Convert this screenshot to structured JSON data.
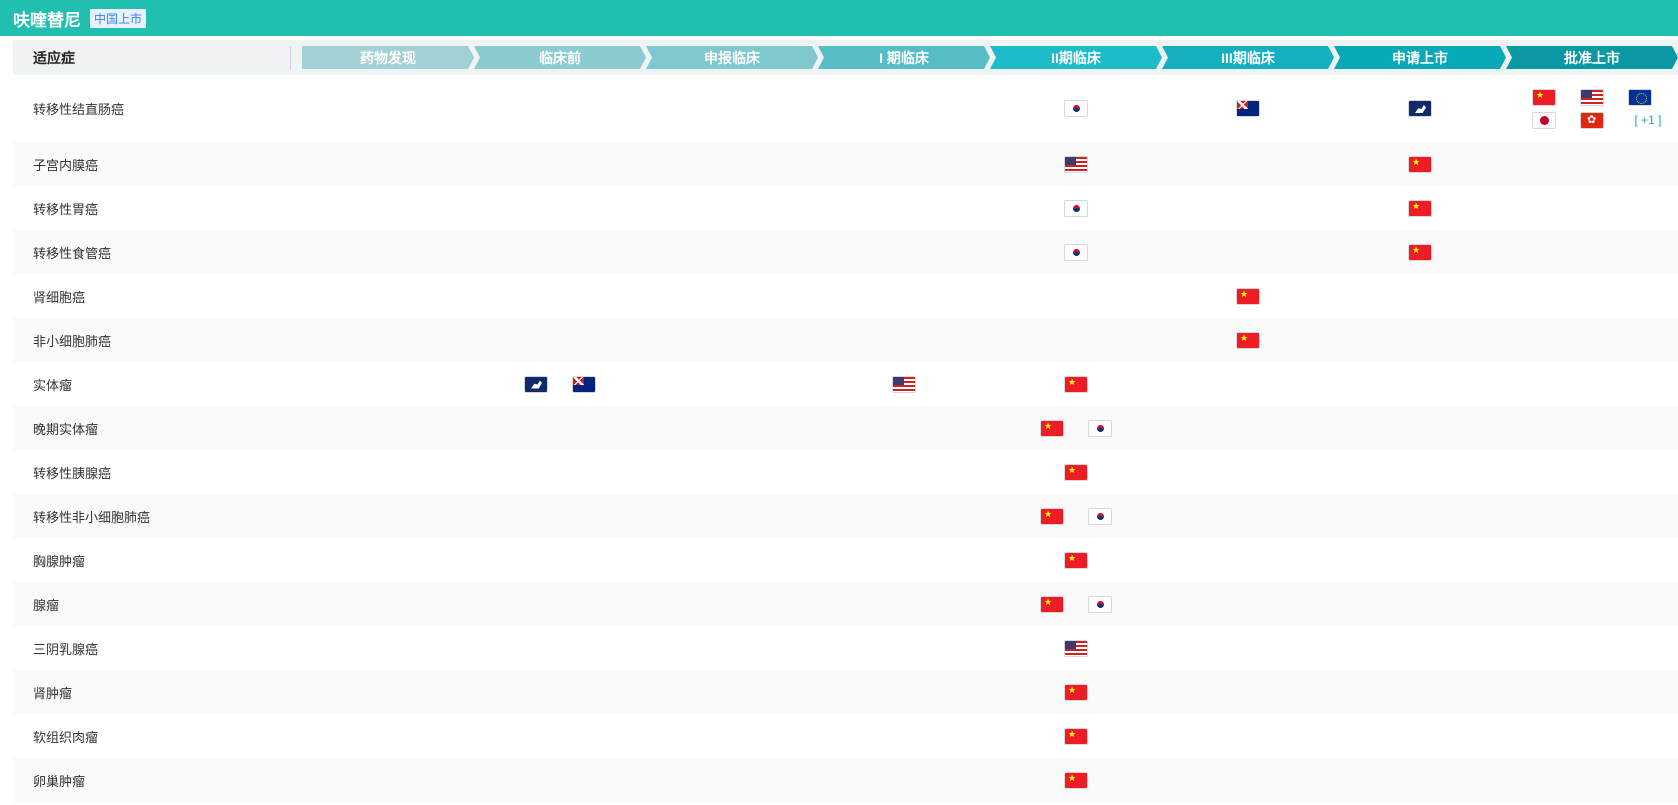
{
  "header": {
    "title": "呋喹替尼",
    "badge": "中国上市"
  },
  "table": {
    "indication_header": "适应症",
    "stages": [
      "药物发现",
      "临床前",
      "申报临床",
      "I 期临床",
      "II期临床",
      "III期临床",
      "申请上市",
      "批准上市"
    ],
    "stage_colors": [
      "#a3d0d5",
      "#8ccbd0",
      "#7ec8ce",
      "#56bdc6",
      "#1ebbc9",
      "#14b0c1",
      "#07a8b8",
      "#0a98a5"
    ],
    "rows": [
      {
        "indication": "转移性结直肠癌",
        "cells": {
          "4": [
            "kr"
          ],
          "5": [
            "au"
          ],
          "6": [
            "eumap"
          ],
          "7": [
            "cn",
            "us",
            "eu",
            "jp",
            "hk"
          ]
        },
        "more": "[ +1 ]"
      },
      {
        "indication": "子宫内膜癌",
        "cells": {
          "4": [
            "us"
          ],
          "6": [
            "cn"
          ]
        }
      },
      {
        "indication": "转移性胃癌",
        "cells": {
          "4": [
            "kr"
          ],
          "6": [
            "cn"
          ]
        }
      },
      {
        "indication": "转移性食管癌",
        "cells": {
          "4": [
            "kr"
          ],
          "6": [
            "cn"
          ]
        }
      },
      {
        "indication": "肾细胞癌",
        "cells": {
          "5": [
            "cn"
          ]
        }
      },
      {
        "indication": "非小细胞肺癌",
        "cells": {
          "5": [
            "cn"
          ]
        }
      },
      {
        "indication": "实体瘤",
        "cells": {
          "1": [
            "eumap",
            "au"
          ],
          "3": [
            "us"
          ],
          "4": [
            "cn"
          ]
        }
      },
      {
        "indication": "晚期实体瘤",
        "cells": {
          "4": [
            "cn",
            "kr"
          ]
        }
      },
      {
        "indication": "转移性胰腺癌",
        "cells": {
          "4": [
            "cn"
          ]
        }
      },
      {
        "indication": "转移性非小细胞肺癌",
        "cells": {
          "4": [
            "cn",
            "kr"
          ]
        }
      },
      {
        "indication": "胸腺肿瘤",
        "cells": {
          "4": [
            "cn"
          ]
        }
      },
      {
        "indication": "腺瘤",
        "cells": {
          "4": [
            "cn",
            "kr"
          ]
        }
      },
      {
        "indication": "三阴乳腺癌",
        "cells": {
          "4": [
            "us"
          ]
        }
      },
      {
        "indication": "肾肿瘤",
        "cells": {
          "4": [
            "cn"
          ]
        }
      },
      {
        "indication": "软组织肉瘤",
        "cells": {
          "4": [
            "cn"
          ]
        }
      },
      {
        "indication": "卵巢肿瘤",
        "cells": {
          "4": [
            "cn"
          ]
        }
      }
    ]
  }
}
